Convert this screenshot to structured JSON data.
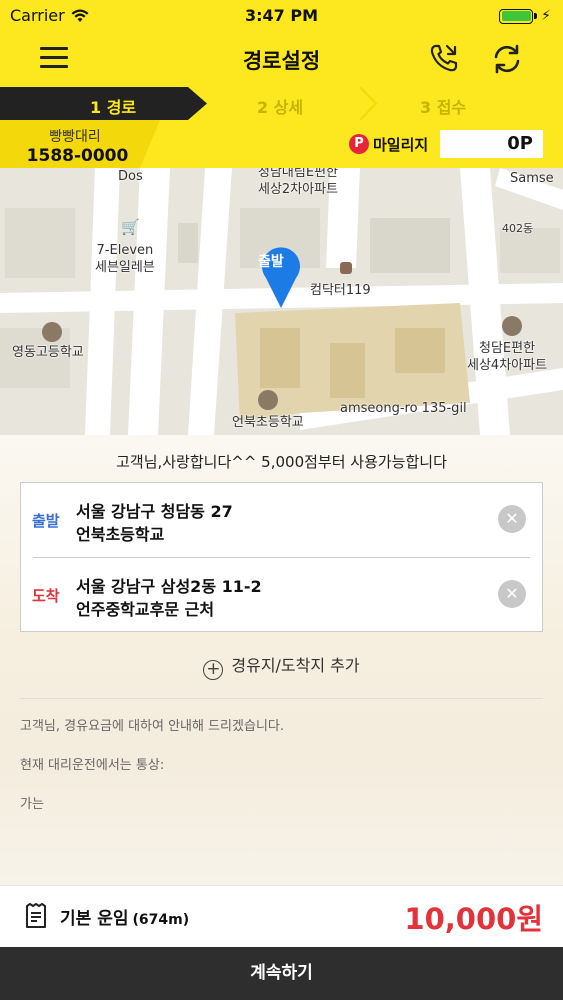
{
  "status_bar": {
    "carrier": "Carrier",
    "time": "3:47 PM"
  },
  "nav": {
    "title": "경로설정",
    "menu_icon": "hamburger-menu-icon",
    "call_icon": "phone-call-icon",
    "refresh_icon": "refresh-icon"
  },
  "steps": [
    {
      "label": "1 경로",
      "active": true
    },
    {
      "label": "2 상세",
      "active": false
    },
    {
      "label": "3 접수",
      "active": false
    }
  ],
  "info": {
    "brand_name": "빵빵대리",
    "brand_phone": "1588-0000",
    "mileage_icon": "P",
    "mileage_label": "마일리지",
    "mileage_value": "0P"
  },
  "map": {
    "start_pin": "출발",
    "labels": {
      "dos": "Dos",
      "samse": "Samse",
      "apt_top": "청담대림E편한\n세상2차아파트",
      "seven_eleven": "7-Eleven\n세븐일레븐",
      "dong402": "402동",
      "computer119": "컴닥터119",
      "school_left": "영동고등학교",
      "apt_right": "청담E편한\n세상4차아파트",
      "school_bottom": "언북초등학교",
      "road": "amseong-ro 135-gil"
    }
  },
  "notice": "고객님,사랑합니다^^ 5,000점부터 사용가능합니다",
  "route": {
    "start": {
      "tag": "출발",
      "address": "서울 강남구 청담동 27",
      "place": "언북초등학교"
    },
    "end": {
      "tag": "도착",
      "address": "서울 강남구 삼성2동 11-2",
      "place": "언주중학교후문 근처"
    },
    "clear_glyph": "✕"
  },
  "add_stop": {
    "glyph": "+",
    "label": "경유지/도착지 추가"
  },
  "guide_lines": [
    "고객님, 경유요금에 대하여 안내해 드리겠습니다.",
    "현재 대리운전에서는 통상:",
    "가는"
  ],
  "fare": {
    "label": "기본 운임",
    "distance": "(674m)",
    "amount": "10,000원"
  },
  "continue_label": "계속하기",
  "colors": {
    "brand_yellow": "#fde81f",
    "dark": "#2e2e2e",
    "accent_red": "#e2323a",
    "start_blue": "#3a6fd1",
    "pin_blue": "#1d7be6"
  }
}
